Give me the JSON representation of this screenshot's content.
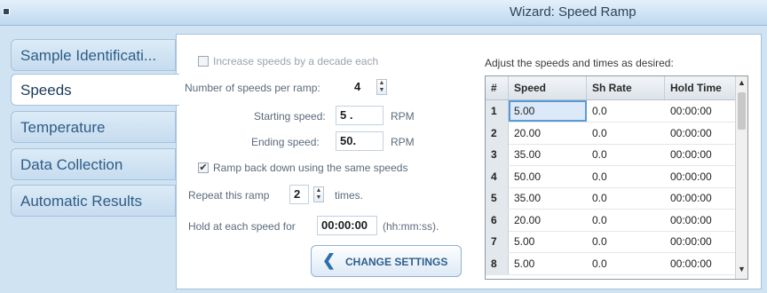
{
  "window": {
    "title": "Wizard: Speed Ramp"
  },
  "tabs": [
    {
      "label": "Sample Identificati...",
      "active": false
    },
    {
      "label": "Speeds",
      "active": true
    },
    {
      "label": "Temperature",
      "active": false
    },
    {
      "label": "Data Collection",
      "active": false
    },
    {
      "label": "Automatic Results",
      "active": false
    }
  ],
  "form": {
    "increase_decade_label": "Increase speeds by a decade each",
    "increase_decade_checked": false,
    "speeds_per_ramp_label": "Number of speeds per ramp:",
    "speeds_per_ramp_value": "4",
    "starting_speed_label": "Starting speed:",
    "starting_speed_value": "5 .",
    "starting_speed_unit": "RPM",
    "ending_speed_label": "Ending speed:",
    "ending_speed_value": "50.",
    "ending_speed_unit": "RPM",
    "ramp_back_label": "Ramp back down using the same speeds",
    "ramp_back_checked": true,
    "ramp_back_mark": "✔",
    "repeat_label": "Repeat this ramp",
    "repeat_value": "2",
    "repeat_suffix": "times.",
    "hold_label": "Hold at each speed for",
    "hold_value": "00:00:00",
    "hold_suffix": "(hh:mm:ss).",
    "change_settings_label": "CHANGE SETTINGS"
  },
  "table": {
    "caption": "Adjust the speeds and times as desired:",
    "headers": [
      "#",
      "Speed",
      "Sh Rate",
      "Hold Time"
    ],
    "rows": [
      [
        "1",
        "5.00",
        "0.0",
        "00:00:00"
      ],
      [
        "2",
        "20.00",
        "0.0",
        "00:00:00"
      ],
      [
        "3",
        "35.00",
        "0.0",
        "00:00:00"
      ],
      [
        "4",
        "50.00",
        "0.0",
        "00:00:00"
      ],
      [
        "5",
        "35.00",
        "0.0",
        "00:00:00"
      ],
      [
        "6",
        "20.00",
        "0.0",
        "00:00:00"
      ],
      [
        "7",
        "5.00",
        "0.0",
        "00:00:00"
      ],
      [
        "8",
        "5.00",
        "0.0",
        "00:00:00"
      ]
    ],
    "selected_row": 1
  },
  "colors": {
    "background": "#cfe3f3",
    "tab_text": "#2f5c86",
    "accent": "#5a9bd6"
  },
  "icons": {
    "system_menu": "window-menu-icon",
    "button": "chevron-left-icon",
    "scroll_up": "scroll-up-icon",
    "scroll_down": "scroll-down-icon"
  }
}
